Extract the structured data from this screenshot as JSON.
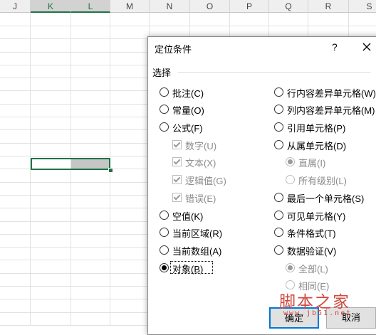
{
  "sheet": {
    "columns": [
      "J",
      "K",
      "L",
      "M",
      "N",
      "O",
      "P",
      "Q",
      "R",
      "S"
    ],
    "selected_columns": [
      "K",
      "L"
    ],
    "accent_color": "#217346"
  },
  "dialog": {
    "title": "定位条件",
    "help": "?",
    "group_label": "选择",
    "left_options": [
      {
        "label": "批注(C)",
        "state": "off",
        "enabled": true
      },
      {
        "label": "常量(O)",
        "state": "off",
        "enabled": true
      },
      {
        "label": "公式(F)",
        "state": "off",
        "enabled": true
      },
      {
        "label": "数字(U)",
        "state": "checked",
        "enabled": false,
        "kind": "checkbox"
      },
      {
        "label": "文本(X)",
        "state": "checked",
        "enabled": false,
        "kind": "checkbox"
      },
      {
        "label": "逻辑值(G)",
        "state": "checked",
        "enabled": false,
        "kind": "checkbox"
      },
      {
        "label": "错误(E)",
        "state": "checked",
        "enabled": false,
        "kind": "checkbox"
      },
      {
        "label": "空值(K)",
        "state": "off",
        "enabled": true
      },
      {
        "label": "当前区域(R)",
        "state": "off",
        "enabled": true
      },
      {
        "label": "当前数组(A)",
        "state": "off",
        "enabled": true
      },
      {
        "label": "对象(B)",
        "state": "on",
        "enabled": true
      }
    ],
    "right_options": [
      {
        "label": "行内容差异单元格(W)",
        "state": "off",
        "enabled": true
      },
      {
        "label": "列内容差异单元格(M)",
        "state": "off",
        "enabled": true
      },
      {
        "label": "引用单元格(P)",
        "state": "off",
        "enabled": true
      },
      {
        "label": "从属单元格(D)",
        "state": "off",
        "enabled": true
      },
      {
        "label": "直属(I)",
        "state": "on",
        "enabled": false
      },
      {
        "label": "所有级别(L)",
        "state": "off",
        "enabled": false
      },
      {
        "label": "最后一个单元格(S)",
        "state": "off",
        "enabled": true
      },
      {
        "label": "可见单元格(Y)",
        "state": "off",
        "enabled": true
      },
      {
        "label": "条件格式(T)",
        "state": "off",
        "enabled": true
      },
      {
        "label": "数据验证(V)",
        "state": "off",
        "enabled": true
      },
      {
        "label": "全部(L)",
        "state": "on",
        "enabled": false
      },
      {
        "label": "相同(E)",
        "state": "off",
        "enabled": false
      }
    ],
    "ok_label": "确定",
    "cancel_label": "取消"
  },
  "watermark": {
    "main": "脚本之家",
    "sub": "www.jb51.net"
  }
}
